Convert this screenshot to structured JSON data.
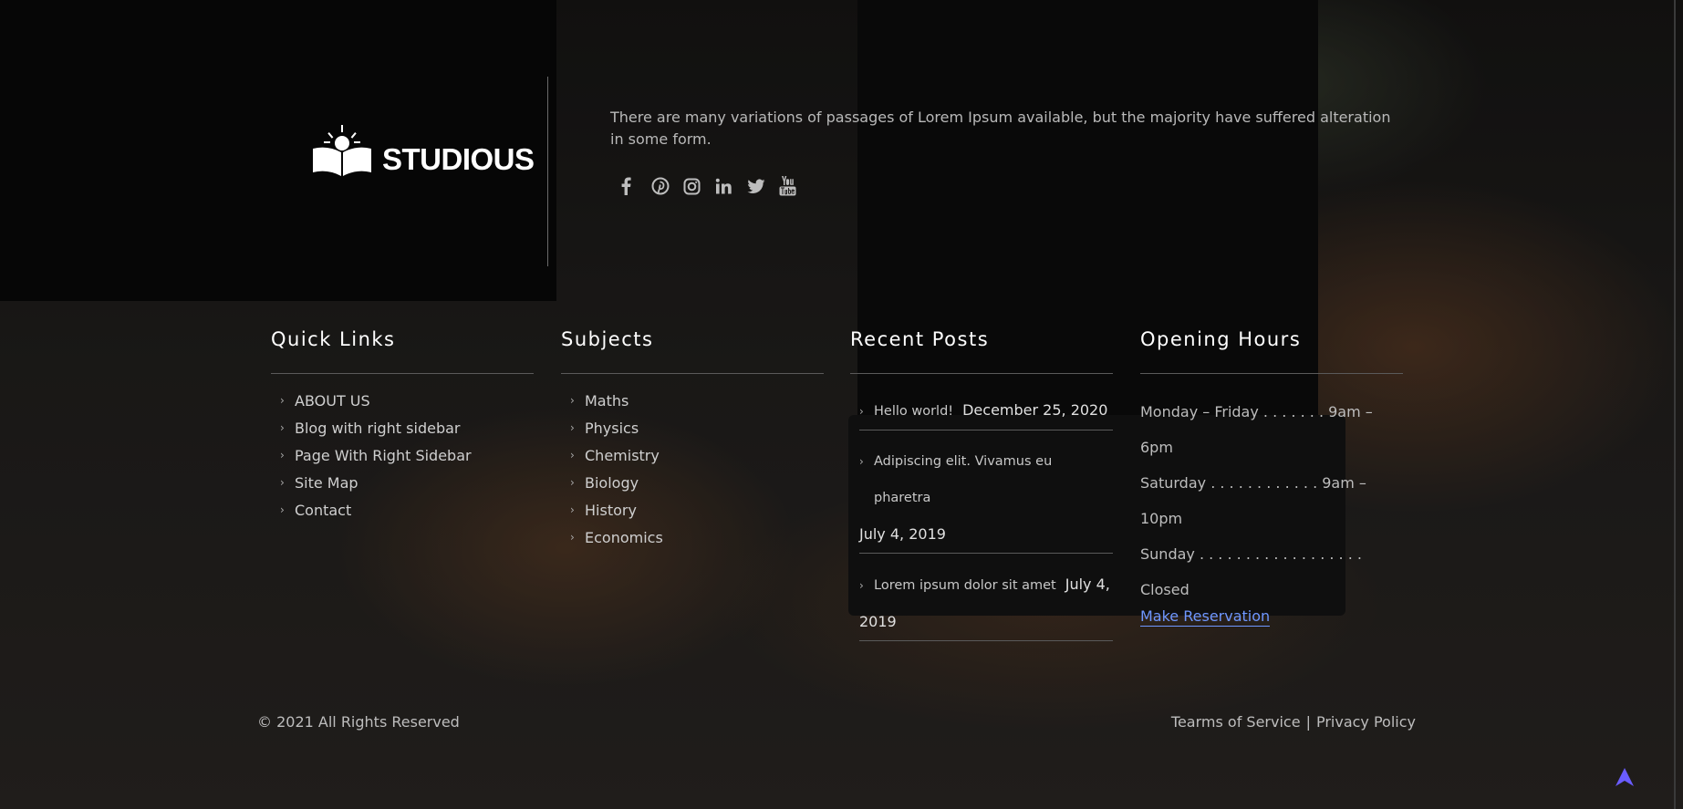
{
  "brand": {
    "name": "STUDIOUS"
  },
  "about": {
    "text": "There are many variations of passages of Lorem Ipsum available, but the majority have suffered alteration in some form."
  },
  "social": [
    {
      "icon": "facebook-icon",
      "glyph": "f"
    },
    {
      "icon": "pinterest-icon",
      "glyph": "p"
    },
    {
      "icon": "instagram-icon",
      "glyph": "ig"
    },
    {
      "icon": "linkedin-icon",
      "glyph": "in"
    },
    {
      "icon": "twitter-icon",
      "glyph": "tw"
    },
    {
      "icon": "youtube-icon",
      "glyph": "yt"
    }
  ],
  "quick_links": {
    "title": "Quick Links",
    "items": [
      "ABOUT US",
      "Blog with right sidebar",
      "Page With Right Sidebar",
      "Site Map",
      "Contact"
    ]
  },
  "subjects": {
    "title": "Subjects",
    "items": [
      "Maths",
      "Physics",
      "Chemistry",
      "Biology",
      "History",
      "Economics"
    ]
  },
  "recent_posts": {
    "title": "Recent Posts",
    "posts": [
      {
        "title": "Hello world!",
        "date": "December 25, 2020"
      },
      {
        "title": "Adipiscing elit. Vivamus eu pharetra",
        "date": "July 4, 2019"
      },
      {
        "title": "Lorem ipsum dolor sit amet",
        "date_part1": "July 4,",
        "date_part2": "2019"
      }
    ]
  },
  "opening_hours": {
    "title": "Opening Hours",
    "rows": [
      "Monday – Friday . . . . . . . 9am – 6pm",
      "Saturday . . . . . . . . . . . . 9am – 10pm",
      "Sunday . . . . . . . . . . . . . . . . . . Closed"
    ],
    "reservation_link": "Make Reservation"
  },
  "footer": {
    "copyright": "© 2021 All Rights Reserved",
    "terms": "Tearms of Service",
    "separator": "|",
    "privacy": "Privacy Policy"
  },
  "colors": {
    "accent_link": "#6f97ff",
    "scroll_top": "#6a5cff"
  }
}
